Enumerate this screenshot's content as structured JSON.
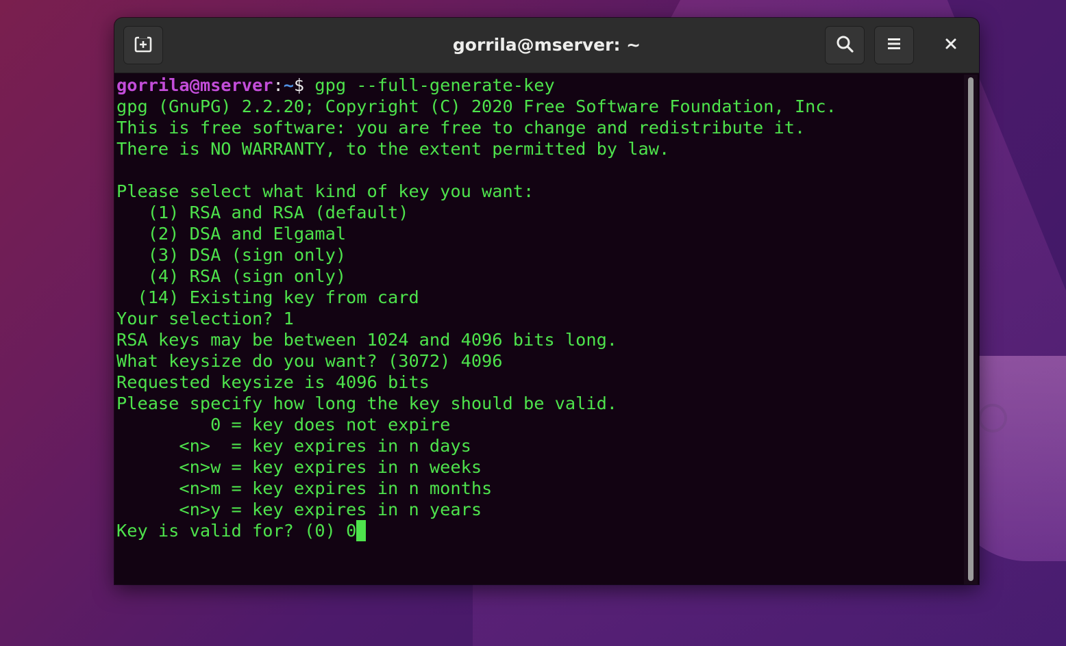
{
  "window": {
    "title": "gorrila@mserver: ~"
  },
  "icons": {
    "new_tab": "new-tab-icon",
    "search": "search-icon",
    "menu": "hamburger-menu-icon",
    "close": "close-icon"
  },
  "colors": {
    "terminal_bg": "#120312",
    "terminal_fg": "#4ee34c",
    "prompt_user": "#c34dd9",
    "prompt_path": "#4f8fe0"
  },
  "prompt": {
    "user_host": "gorrila@mserver",
    "separator": ":",
    "path": "~",
    "symbol": "$",
    "command": " gpg --full-generate-key"
  },
  "output": [
    "gpg (GnuPG) 2.2.20; Copyright (C) 2020 Free Software Foundation, Inc.",
    "This is free software: you are free to change and redistribute it.",
    "There is NO WARRANTY, to the extent permitted by law.",
    "",
    "Please select what kind of key you want:",
    "   (1) RSA and RSA (default)",
    "   (2) DSA and Elgamal",
    "   (3) DSA (sign only)",
    "   (4) RSA (sign only)",
    "  (14) Existing key from card",
    "Your selection? 1",
    "RSA keys may be between 1024 and 4096 bits long.",
    "What keysize do you want? (3072) 4096",
    "Requested keysize is 4096 bits",
    "Please specify how long the key should be valid.",
    "         0 = key does not expire",
    "      <n>  = key expires in n days",
    "      <n>w = key expires in n weeks",
    "      <n>m = key expires in n months",
    "      <n>y = key expires in n years"
  ],
  "input_line": {
    "prompt": "Key is valid for? (0) ",
    "value": "0"
  }
}
